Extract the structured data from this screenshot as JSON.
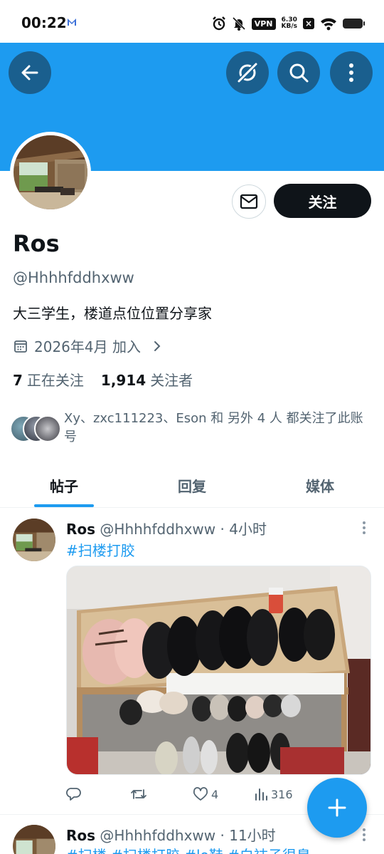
{
  "status_bar": {
    "time": "00:22",
    "vpn": "VPN",
    "speed_value": "6.30",
    "speed_unit": "KB/s",
    "icons": [
      "mail-icon",
      "alarm-icon",
      "mute-icon",
      "vpn-icon",
      "network-speed",
      "x-icon",
      "wifi-icon",
      "battery-icon"
    ]
  },
  "header": {
    "back_icon": "arrow-left-icon",
    "grok_icon": "grok-icon",
    "search_icon": "search-icon",
    "more_icon": "more-vertical-icon",
    "banner_color": "#1d9bf0"
  },
  "profile": {
    "name": "Ros",
    "handle": "@Hhhhfddhxww",
    "bio": "大三学生，楼道点位位置分享家",
    "joined": "2026年4月 加入",
    "following_count": "7",
    "following_label": "正在关注",
    "followers_count": "1,914",
    "followers_label": "关注者",
    "follow_button": "关注",
    "mutuals_text": "Xy、zxc111223、Eson 和 另外 4 人 都关注了此账号"
  },
  "tabs": [
    {
      "label": "帖子",
      "active": true
    },
    {
      "label": "回复",
      "active": false
    },
    {
      "label": "媒体",
      "active": false
    }
  ],
  "posts": [
    {
      "name": "Ros",
      "handle": "@Hhhhfddhxww",
      "time": "· 4小时",
      "hashtags": "#扫楼打胶",
      "likes": "4",
      "views": "316"
    },
    {
      "name": "Ros",
      "handle": "@Hhhhfddhxww",
      "time": "· 11小时",
      "hashtags": "#扫楼 #扫楼打胶 #lo鞋 #白袜子很臭"
    }
  ],
  "fab": {
    "icon": "plus-icon"
  },
  "colors": {
    "accent": "#1d9bf0",
    "text": "#0f1419",
    "secondary": "#536471"
  }
}
